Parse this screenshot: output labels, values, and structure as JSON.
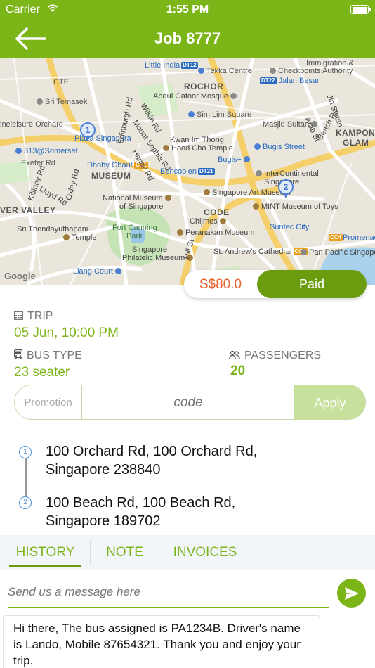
{
  "status_bar": {
    "carrier": "Carrier",
    "time": "1:55 PM"
  },
  "header": {
    "title": "Job 8777"
  },
  "map": {
    "attribution": "Google",
    "labels": {
      "little_india": "Little India",
      "little_india_mrt": "DT12",
      "tekka": "Tekka Centre",
      "immigration": "Immigration &",
      "checkpoints": "Checkpoints Authority",
      "jalan_besar": "Jalan Besar",
      "jalan_besar_mrt": "DT22",
      "rochor": "ROCHOR",
      "mosque": "Abdul Gafoor Mosque",
      "temasek": "Sri Temasek",
      "cte": "CTE",
      "sim_lim": "Sim Lim Square",
      "masjid": "Masjid Sultan",
      "kampong": "KAMPON",
      "glam": "GLAM",
      "orchard": "ineleisure Orchard",
      "plaza": "Plaza Singapura",
      "kwan_im": "Kwan Im Thong",
      "hood_cho": "Hood Cho Temple",
      "bugis_street": "Bugis Street",
      "somerset": "313@Somerset",
      "dhoby": "Dhoby Ghaut",
      "dhoby_mrt": "CC1",
      "bugis_plus": "Bugis+",
      "exeter": "Exeter Rd",
      "museum": "MUSEUM",
      "bencoolen": "Bencoolen",
      "bencoolen_mrt": "DT21",
      "intercontinental": "InterContinental",
      "singapore_short": "Singapore",
      "sam": "Singapore Art Museum",
      "national_museum": "National Museum",
      "of_singapore": "of Singapore",
      "code": "CODE",
      "mint": "MINT Museum of Toys",
      "river_valley": "VER VALLEY",
      "chijmes": "Chijmes",
      "fort_canning": "Fort Canning",
      "park": "Park",
      "suntec": "Suntec City",
      "thendayuthapani": "Sri Thendayuthapani",
      "temple": "Temple",
      "peranakan": "Peranakan Museum",
      "promenade": "Promenade",
      "promenade_mrt": "CC4",
      "philatelic": "Singapore",
      "philatelic2": "Philatelic Museum",
      "st_andrews": "St. Andrew's Cathedral",
      "st_andrews_mrt": "CC3",
      "pan_pacific": "Pan Pacific Singapo",
      "liang_court": "Liang Court",
      "hill_st": "Hill St",
      "killiney": "Killiney Rd",
      "oxley": "Oxley Rd",
      "lloyd": "Lloyd Rd",
      "wilkie": "Wilkie Rd",
      "edinburgh": "Edinburgh Rd",
      "mount_sophia": "Mount Sophia Rd",
      "handy": "Handy Rd",
      "jln_sultan": "Jln Sultan",
      "arab": "Arab St",
      "beach": "Beach Rd"
    },
    "pins": [
      "1",
      "2"
    ]
  },
  "fare": {
    "price": "S$80.0",
    "status": "Paid"
  },
  "trip": {
    "label": "TRIP",
    "value": "05 Jun, 10:00 PM"
  },
  "bus_type": {
    "label": "BUS TYPE",
    "value": "23 seater"
  },
  "passengers": {
    "label": "PASSENGERS",
    "value": "20"
  },
  "promotion": {
    "label": "Promotion",
    "placeholder": "code",
    "apply_label": "Apply"
  },
  "route": {
    "stops": [
      {
        "index": "1",
        "line1": "100 Orchard Rd, 100 Orchard Rd,",
        "line2": "Singapore 238840"
      },
      {
        "index": "2",
        "line1": "100 Beach Rd, 100 Beach Rd,",
        "line2": "Singapore 189702"
      }
    ]
  },
  "tabs": [
    {
      "label": "HISTORY",
      "active": true
    },
    {
      "label": "NOTE",
      "active": false
    },
    {
      "label": "INVOICES",
      "active": false
    }
  ],
  "message": {
    "placeholder": "Send us a message here",
    "history": "Hi there, The bus assigned is PA1234B. Driver's name is Lando, Mobile 87654321. Thank you and enjoy your trip."
  },
  "colors": {
    "brand": "#7cb518",
    "paid": "#6a9c0f",
    "price": "#e8622c",
    "apply": "#c7e09b",
    "route": "#4a8fd4"
  },
  "icons": [
    "back-arrow-icon",
    "wifi-icon",
    "battery-icon",
    "calendar-icon",
    "bus-icon",
    "people-icon",
    "send-icon",
    "map-pin-icon"
  ]
}
